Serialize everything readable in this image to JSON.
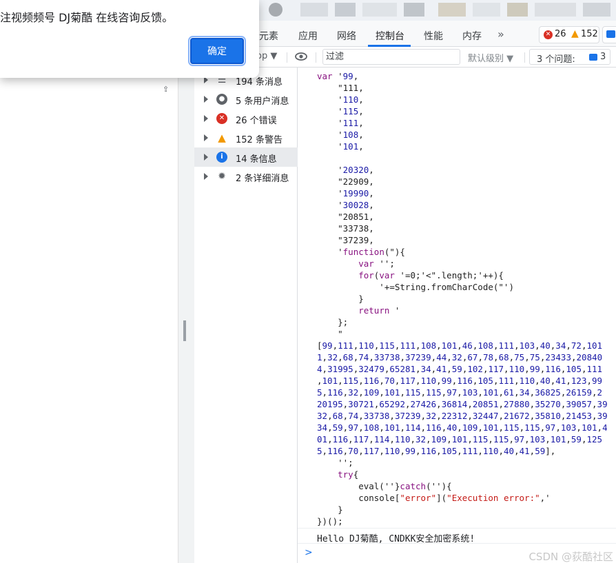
{
  "alert": {
    "message": "注视频频号 DJ菊酷 在线咨询反馈。",
    "ok_label": "确定"
  },
  "devtools": {
    "tabs": [
      "元素",
      "应用",
      "网络",
      "控制台",
      "性能",
      "内存"
    ],
    "active_tab": "控制台",
    "more_tabs_icon": "»",
    "error_count": "26",
    "warning_count": "152",
    "colors": {
      "accent": "#1a73e8",
      "error": "#d93025",
      "warning": "#f29900",
      "selected": "#e8eaed"
    }
  },
  "toolbar": {
    "context": "op ▼",
    "filter_placeholder": "过滤",
    "levels": "默认级别 ▼",
    "issues_label": "3 个问题:",
    "issues_count": "3"
  },
  "sidebar": {
    "items": [
      {
        "label": "194 条消息",
        "icon": "list-icon"
      },
      {
        "label": "5 条用户消息",
        "icon": "user-icon"
      },
      {
        "label": "26 个错误",
        "icon": "error-icon"
      },
      {
        "label": "152 条警告",
        "icon": "warning-icon"
      },
      {
        "label": "14 条信息",
        "icon": "info-icon"
      },
      {
        "label": "2 条详细消息",
        "icon": "bug-icon"
      }
    ],
    "selected_index": 4
  },
  "console": {
    "code_lines": [
      "var '99,",
      "    \"111,",
      "    '110,",
      "    '115,",
      "    '111,",
      "    '108,",
      "    '101,",
      "",
      "    '20320,",
      "    \"22909,",
      "    '19990,",
      "    '30028,",
      "    \"20851,",
      "    \"33738,",
      "    \"37239,",
      "    'function(\"){",
      "        var '';",
      "        for(var '=0;'<\".length;'++){",
      "            '+=String.fromCharCode(\"')",
      "        }",
      "        return '",
      "    };",
      "    \"",
      "[99,111,110,115,111,108,101,46,108,111,103,40,34,72,101",
      "1,32,68,74,33738,37239,44,32,67,78,68,75,75,23433,20840",
      "4,31995,32479,65281,34,41,59,102,117,110,99,116,105,111",
      ",101,115,116,70,117,110,99,116,105,111,110,40,41,123,99",
      "5,116,32,109,101,115,115,97,103,101,61,34,36825,26159,2",
      "20195,30721,65292,27426,36814,20851,27880,35270,39057,39",
      "32,68,74,33738,37239,32,22312,32447,21672,35810,21453,39",
      "34,59,97,108,101,114,116,40,109,101,115,115,97,103,101,4",
      "01,116,117,114,110,32,109,101,115,115,97,103,101,59,125",
      "5,116,70,117,110,99,116,105,111,110,40,41,59],",
      "    '';",
      "    try{",
      "        eval(''}catch(''){",
      "        console[\"error\"](\"Execution error:\",'",
      "    }",
      "})();"
    ],
    "output": "Hello DJ菊酷, CNDKK安全加密系统!",
    "prompt_symbol": ">",
    "watermark": "CSDN @荻酷社区"
  }
}
